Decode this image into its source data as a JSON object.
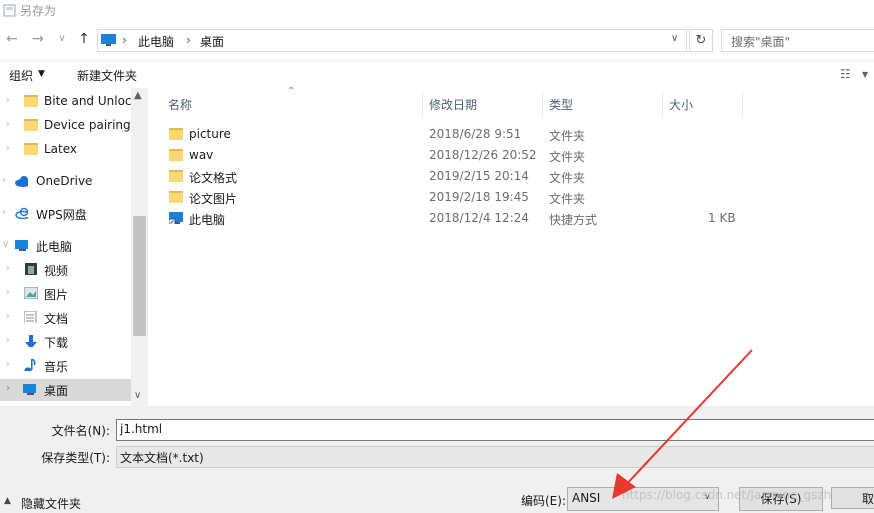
{
  "window": {
    "title": "另存为"
  },
  "nav": {
    "path": [
      "此电脑",
      "桌面"
    ],
    "search_placeholder": "搜索\"桌面\""
  },
  "toolbar": {
    "organize": "组织",
    "new_folder": "新建文件夹"
  },
  "sidebar": {
    "items": [
      {
        "label": "Bite and Unloc",
        "icon": "folder-icon"
      },
      {
        "label": "Device pairing",
        "icon": "folder-icon"
      },
      {
        "label": "Latex",
        "icon": "folder-icon"
      },
      {
        "label": "OneDrive",
        "icon": "cloud-icon"
      },
      {
        "label": "WPS网盘",
        "icon": "cloud-outline-icon"
      },
      {
        "label": "此电脑",
        "icon": "computer-icon"
      },
      {
        "label": "视频",
        "icon": "video-icon"
      },
      {
        "label": "图片",
        "icon": "image-icon"
      },
      {
        "label": "文档",
        "icon": "document-icon"
      },
      {
        "label": "下载",
        "icon": "download-icon"
      },
      {
        "label": "音乐",
        "icon": "music-icon"
      },
      {
        "label": "桌面",
        "icon": "desktop-icon",
        "selected": true
      }
    ]
  },
  "filelist": {
    "headers": {
      "name": "名称",
      "date": "修改日期",
      "type": "类型",
      "size": "大小"
    },
    "rows": [
      {
        "name": "picture",
        "date": "2018/6/28 9:51",
        "type": "文件夹",
        "size": "",
        "icon": "folder-icon"
      },
      {
        "name": "wav",
        "date": "2018/12/26 20:52",
        "type": "文件夹",
        "size": "",
        "icon": "folder-icon"
      },
      {
        "name": "论文格式",
        "date": "2019/2/15 20:14",
        "type": "文件夹",
        "size": "",
        "icon": "folder-icon"
      },
      {
        "name": "论文图片",
        "date": "2019/2/18 19:45",
        "type": "文件夹",
        "size": "",
        "icon": "folder-icon"
      },
      {
        "name": "此电脑",
        "date": "2018/12/4 12:24",
        "type": "快捷方式",
        "size": "1 KB",
        "icon": "shortcut-icon"
      }
    ]
  },
  "form": {
    "filename_label": "文件名(N):",
    "filename_value": "j1.html",
    "filetype_label": "保存类型(T):",
    "filetype_value": "文本文档(*.txt)",
    "encoding_label": "编码(E):",
    "encoding_value": "ANSI",
    "hide_folders": "隐藏文件夹",
    "save": "保存(S)",
    "cancel": "取"
  },
  "watermark": "https://blog.csdn.net/Jasmine_gszh",
  "colors": {
    "selected_bg": "#d9d9d9",
    "folder": "#f8d775",
    "arrow": "#e8392f",
    "header_text": "#4c607a"
  }
}
